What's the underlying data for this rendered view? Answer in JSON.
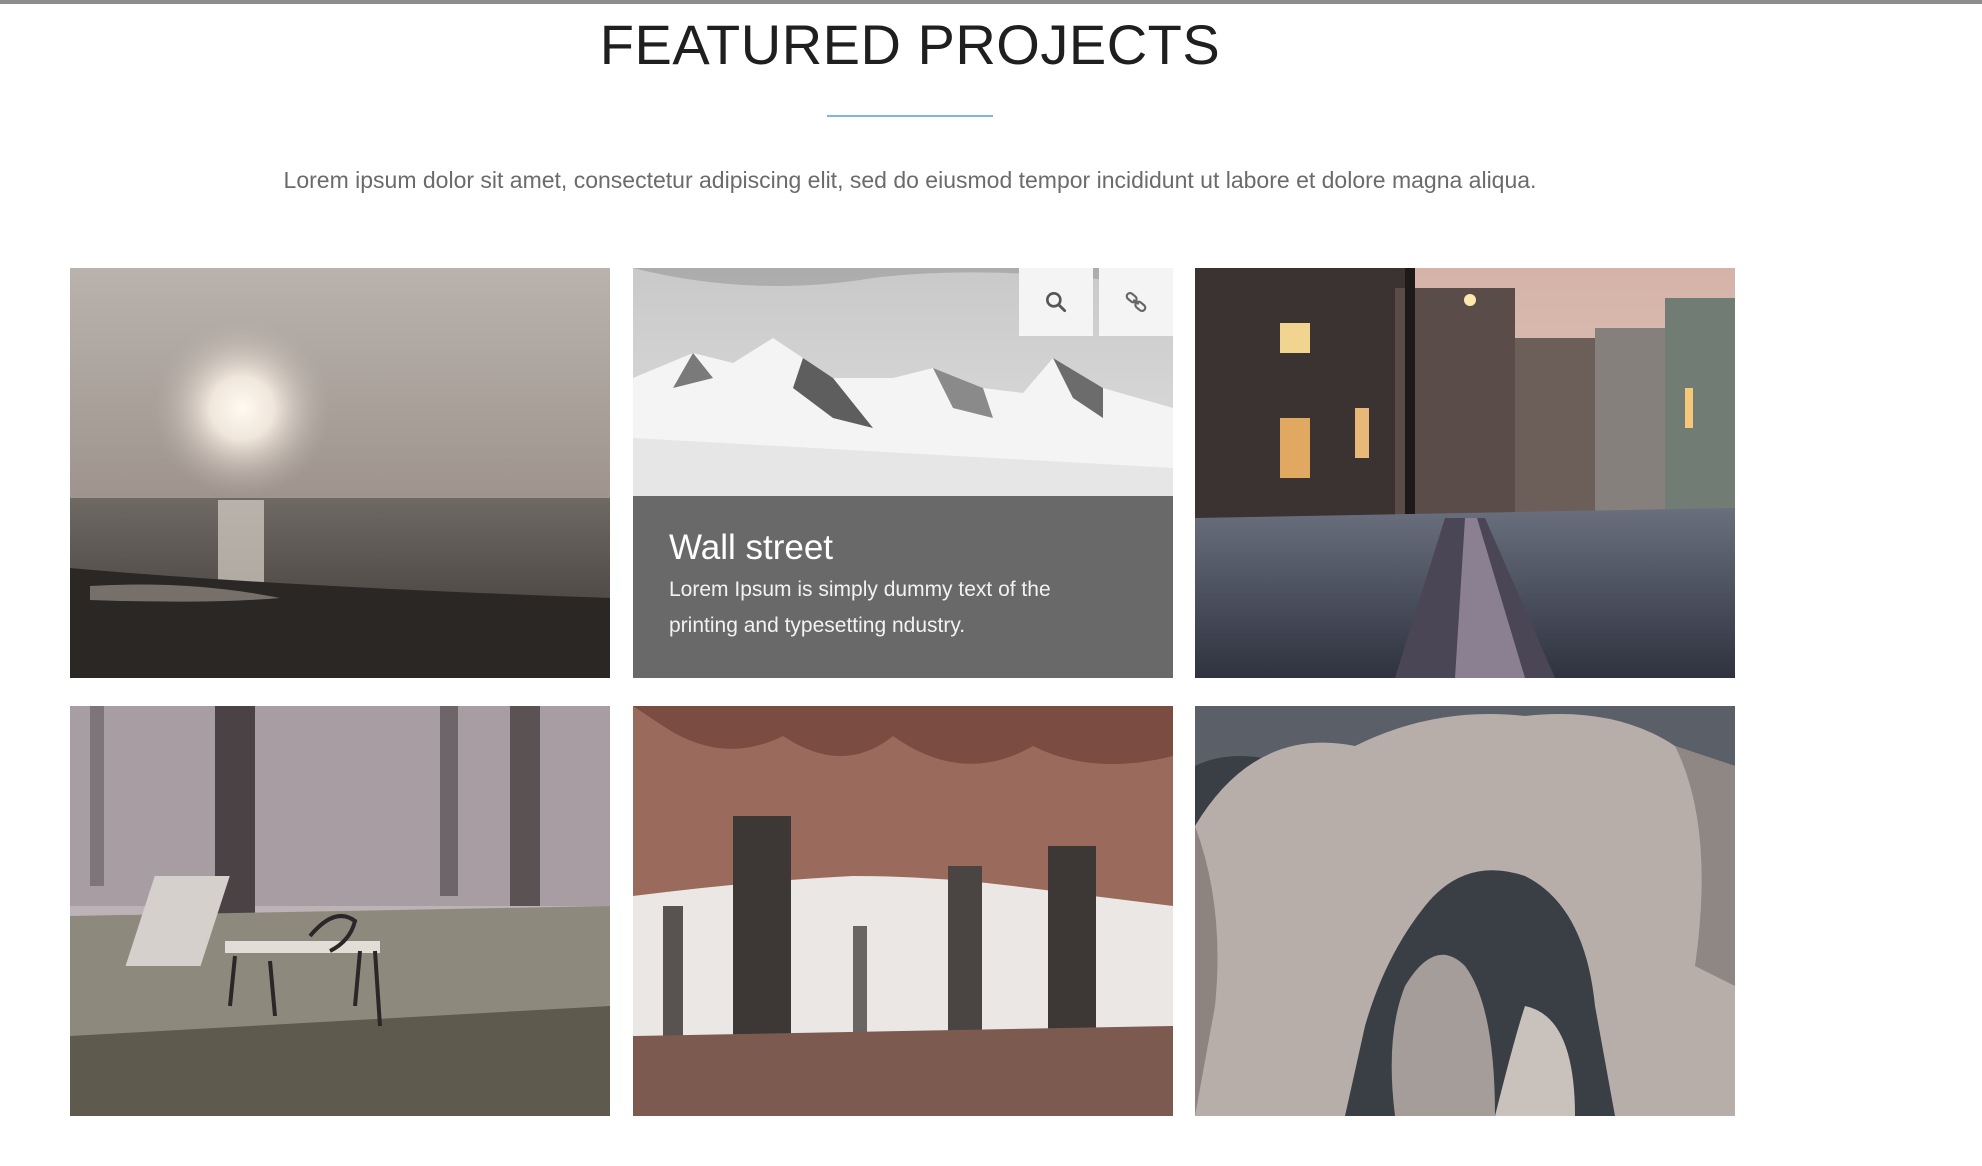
{
  "section": {
    "title": "FEATURED PROJECTS",
    "lead": "Lorem ipsum dolor sit amet, consectetur adipiscing elit, sed do eiusmod tempor incididunt ut labore et dolore magna aliqua."
  },
  "accent_color": "#7fb6dd",
  "projects": [
    {
      "image": "sunset-over-sea-photo"
    },
    {
      "image": "snowy-mountains-photo",
      "title": "Wall street",
      "description": "Lorem Ipsum is simply dummy text of the printing and typesetting ndustry.",
      "actions": [
        {
          "icon": "search-icon"
        },
        {
          "icon": "link-icon"
        }
      ]
    },
    {
      "image": "cobblestone-street-at-dusk-photo"
    },
    {
      "image": "park-bench-in-fog-photo"
    },
    {
      "image": "autumn-trees-photo"
    },
    {
      "image": "rock-arch-photo"
    }
  ]
}
